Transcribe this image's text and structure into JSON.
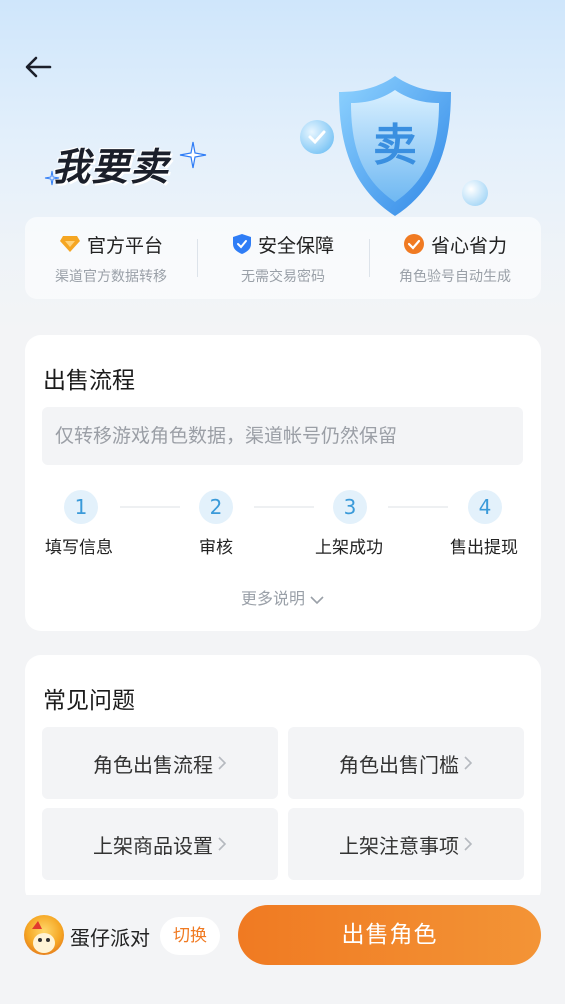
{
  "header": {
    "title": "我要卖",
    "shield_text": "卖",
    "back_icon": "arrow-left-icon"
  },
  "features": [
    {
      "icon": "diamond-icon",
      "color": "#f5a623",
      "title": "官方平台",
      "sub": "渠道官方数据转移"
    },
    {
      "icon": "shield-check-icon",
      "color": "#2f7df6",
      "title": "安全保障",
      "sub": "无需交易密码"
    },
    {
      "icon": "check-badge-icon",
      "color": "#f07a22",
      "title": "省心省力",
      "sub": "角色验号自动生成"
    }
  ],
  "flow": {
    "title": "出售流程",
    "notice": "仅转移游戏角色数据，渠道帐号仍然保留",
    "steps": [
      {
        "num": "1",
        "label": "填写信息"
      },
      {
        "num": "2",
        "label": "审核"
      },
      {
        "num": "3",
        "label": "上架成功"
      },
      {
        "num": "4",
        "label": "售出提现"
      }
    ],
    "more": "更多说明"
  },
  "faq": {
    "title": "常见问题",
    "items": [
      "角色出售流程",
      "角色出售门槛",
      "上架商品设置",
      "上架注意事项"
    ]
  },
  "bottom": {
    "game_name": "蛋仔派对",
    "switch": "切换",
    "sell": "出售角色"
  },
  "colors": {
    "accent": "#f07a22",
    "step": "#3a9ad9"
  }
}
